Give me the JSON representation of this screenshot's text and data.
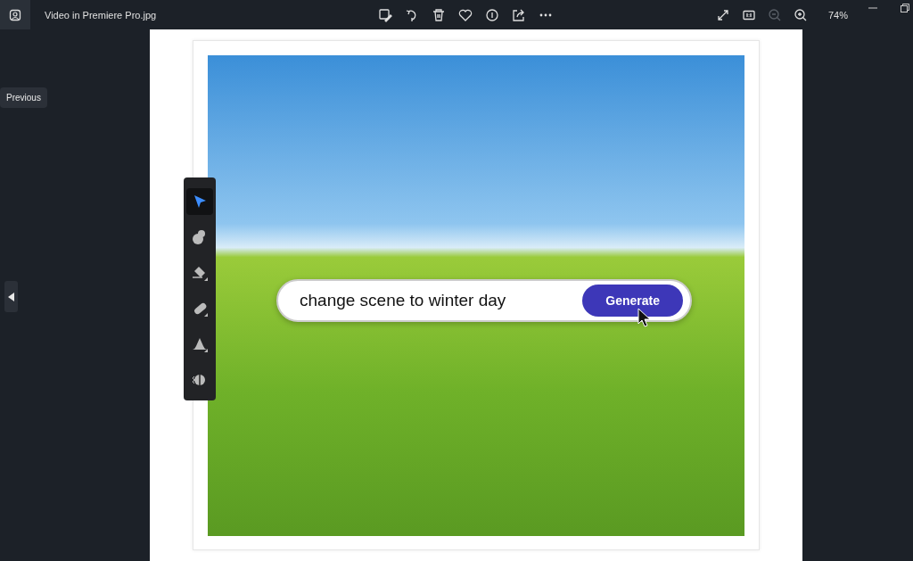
{
  "window": {
    "title": "Video in Premiere Pro.jpg"
  },
  "actions": [
    {
      "kind": "edit",
      "disabled": false
    },
    {
      "kind": "rotate",
      "disabled": false
    },
    {
      "kind": "delete",
      "disabled": false
    },
    {
      "kind": "favorite",
      "disabled": false
    },
    {
      "kind": "info",
      "disabled": false
    },
    {
      "kind": "share",
      "disabled": false
    },
    {
      "kind": "more",
      "disabled": false
    }
  ],
  "view_controls": [
    {
      "kind": "fullscreen",
      "disabled": false
    },
    {
      "kind": "actual-size",
      "disabled": false
    },
    {
      "kind": "zoom-out",
      "disabled": true
    },
    {
      "kind": "zoom-in",
      "disabled": false
    }
  ],
  "zoom": "74%",
  "tooltip": "Previous",
  "image": {
    "tools": [
      {
        "kind": "select",
        "selected": true,
        "submenu": false
      },
      {
        "kind": "blob",
        "selected": false,
        "submenu": false
      },
      {
        "kind": "eraser",
        "selected": false,
        "submenu": true
      },
      {
        "kind": "pill",
        "selected": false,
        "submenu": true
      },
      {
        "kind": "fill",
        "selected": false,
        "submenu": true
      },
      {
        "kind": "contrast",
        "selected": false,
        "submenu": false
      }
    ],
    "prompt": {
      "value": "change scene to winter day"
    },
    "button": "Generate"
  }
}
